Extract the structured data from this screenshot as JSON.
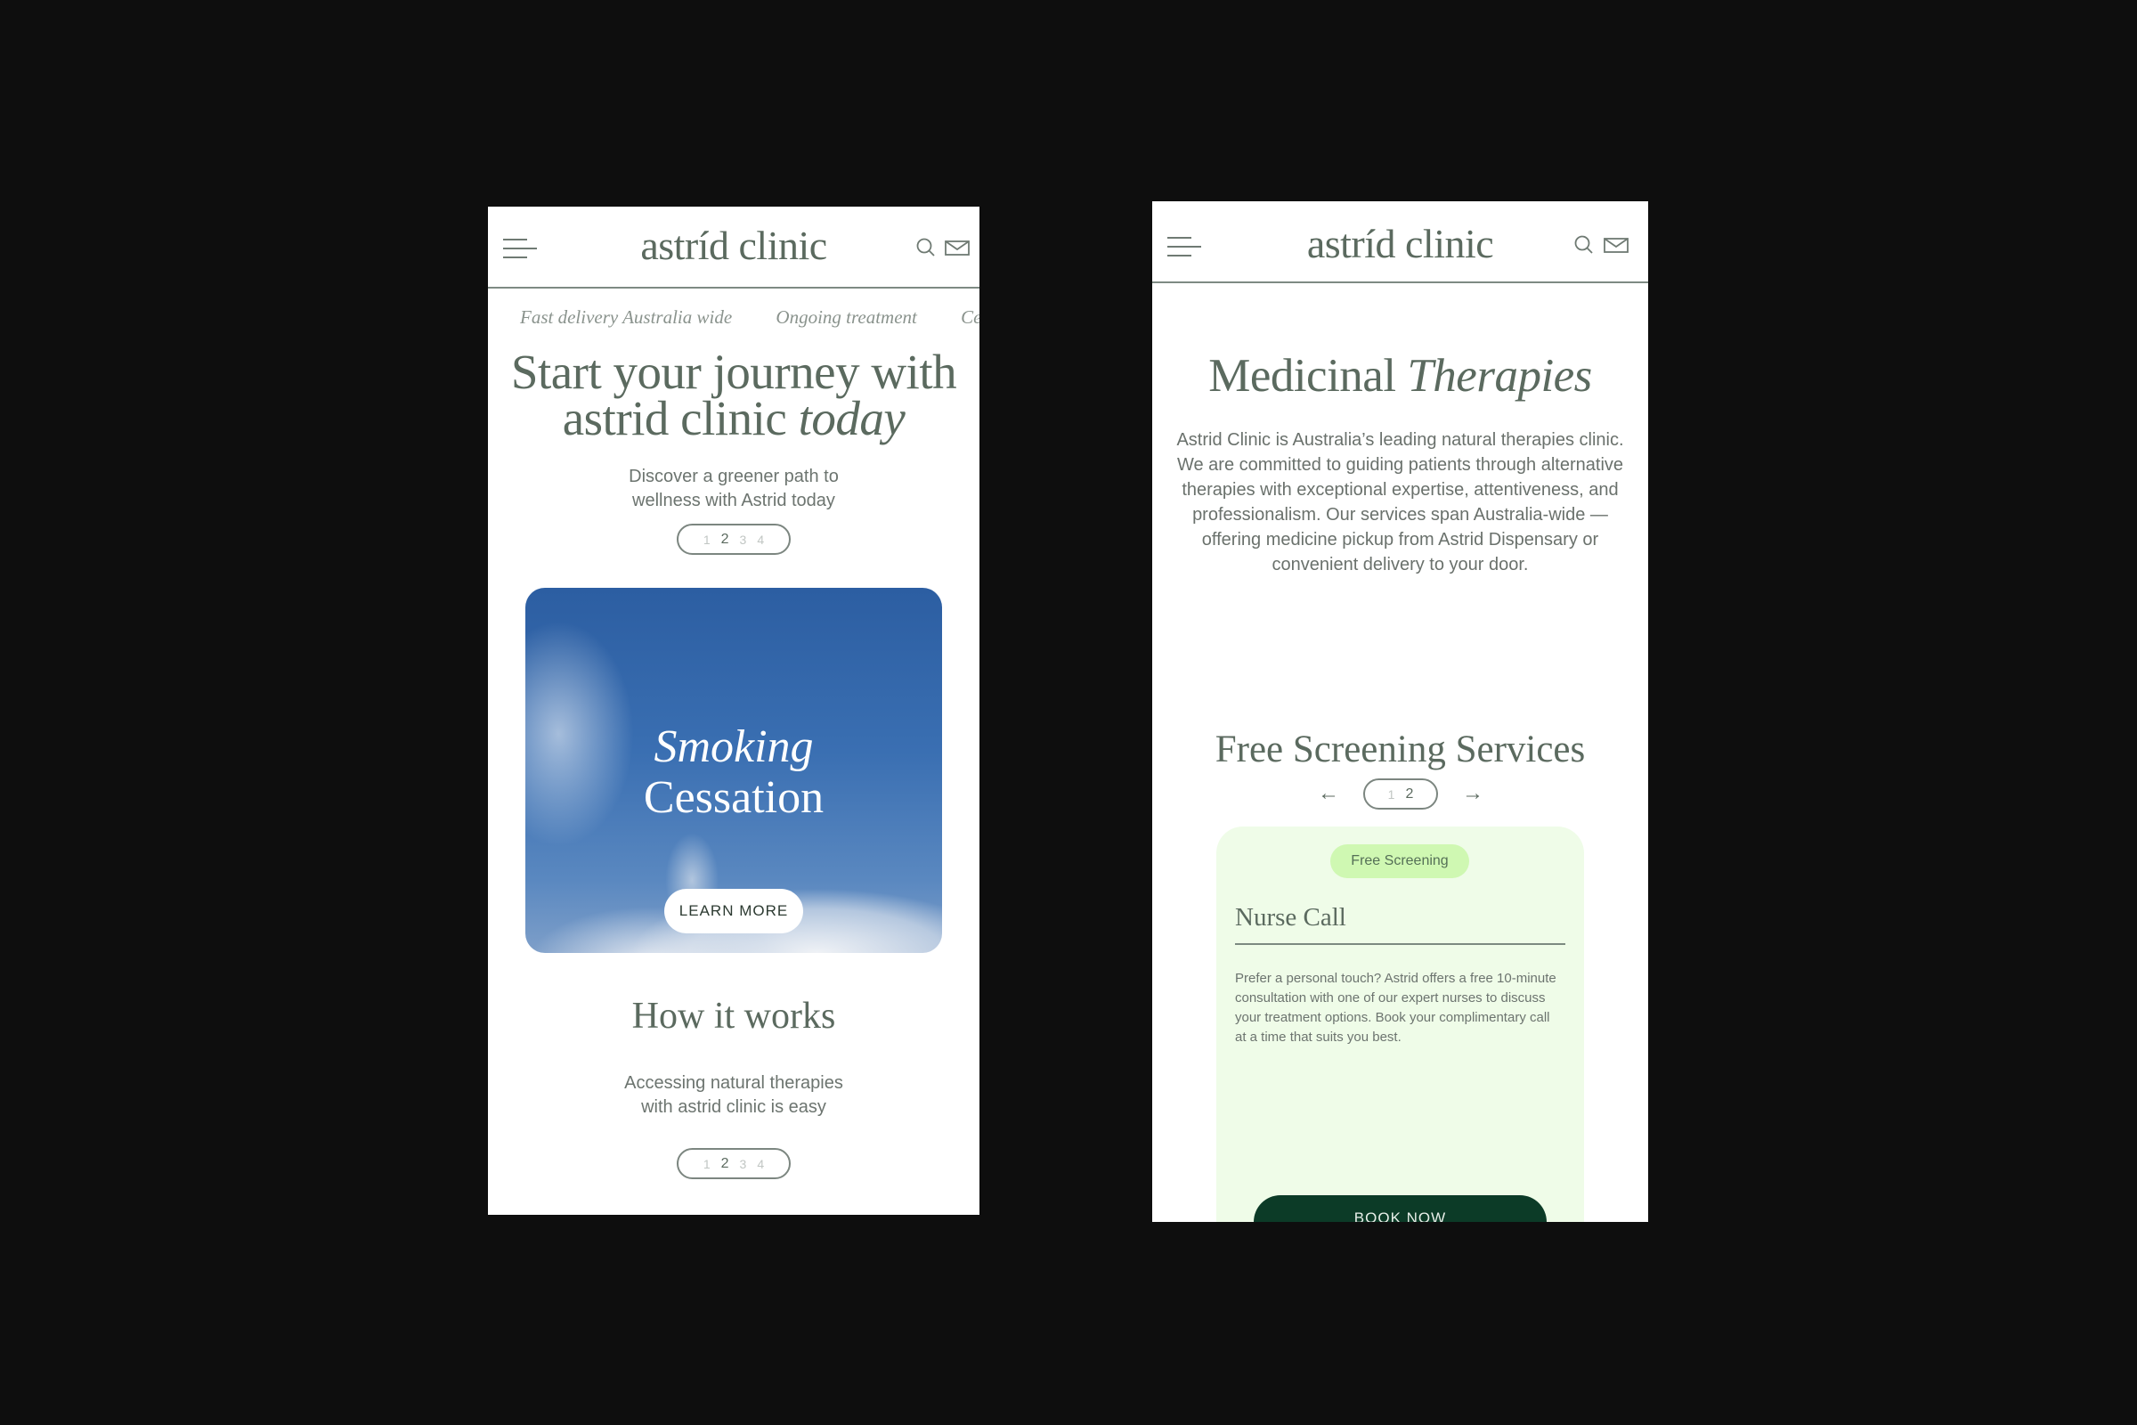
{
  "brand": {
    "logo": "astríd clinic",
    "colors": {
      "ink": "#5b6a5f",
      "background": "#0e0e0e",
      "card_mint": "#effce8",
      "badge_green": "#cff8b2",
      "cta_dark_green": "#0c3b27"
    }
  },
  "header": {
    "menu_icon": "hamburger-menu-icon",
    "search_icon": "search-icon",
    "mail_icon": "mail-icon"
  },
  "left_screen": {
    "ticker": [
      "Fast delivery Australia wide",
      "Ongoing treatment",
      "Cer"
    ],
    "hero": {
      "title_line1": "Start your journey with",
      "title_line2_regular": "astrid clinic ",
      "title_line2_italic": "today",
      "subtitle_line1": "Discover a greener path to",
      "subtitle_line2": "wellness with Astrid today",
      "pager": {
        "pages": [
          "1",
          "2",
          "3",
          "4"
        ],
        "active": "2"
      }
    },
    "feature_card": {
      "title_italic": "Smoking",
      "title_regular": "Cessation",
      "button_label": "LEARN MORE",
      "image": "blue sky with clouds"
    },
    "how_it_works": {
      "title": "How it works",
      "subtitle_line1": "Accessing natural therapies",
      "subtitle_line2": "with astrid clinic is easy",
      "pager": {
        "pages": [
          "1",
          "2",
          "3",
          "4"
        ],
        "active": "2"
      }
    }
  },
  "right_screen": {
    "intro": {
      "title_regular": "Medicinal ",
      "title_italic": "Therapies",
      "paragraph": "Astrid Clinic is Australia’s leading natural therapies clinic. We are committed to guiding patients through alternative therapies with exceptional expertise, attentiveness, and professionalism. Our services span Australia-wide — offering medicine pickup from Astrid Dispensary or convenient delivery to your door."
    },
    "screening": {
      "title": "Free Screening Services",
      "prev_arrow": "←",
      "next_arrow": "→",
      "pager": {
        "pages": [
          "1",
          "2"
        ],
        "active": "2"
      },
      "card": {
        "badge": "Free Screening",
        "title": "Nurse Call",
        "description": "Prefer a personal touch? Astrid offers a free 10-minute consultation with one of our expert nurses to discuss your treatment options. Book your complimentary call at a time that suits you best.",
        "button_label": "BOOK NOW"
      }
    }
  }
}
